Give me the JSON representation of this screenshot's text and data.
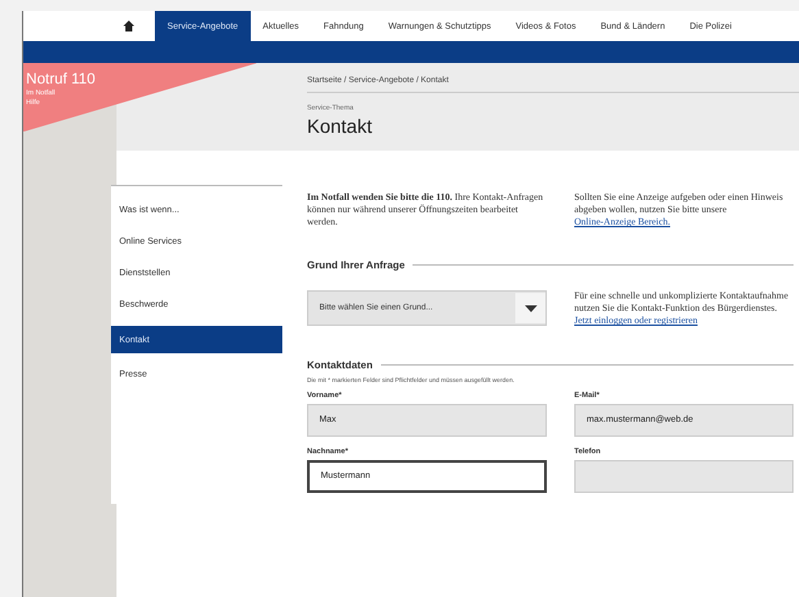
{
  "nav": {
    "items": [
      {
        "label": "Service-Angebote",
        "selected": true
      },
      {
        "label": "Aktuelles",
        "selected": false
      },
      {
        "label": "Fahndung",
        "selected": false
      },
      {
        "label": "Warnungen & Schutztipps",
        "selected": false
      },
      {
        "label": "Videos & Fotos",
        "selected": false
      },
      {
        "label": "Bund & Ländern",
        "selected": false
      },
      {
        "label": "Die Polizei",
        "selected": false
      }
    ]
  },
  "banner": {
    "title": "Notruf 110",
    "subtitle": "Im Notfall",
    "note": "Hilfe"
  },
  "breadcrumb": "Startseite / Service-Angebote / Kontakt",
  "page": {
    "kicker": "Service-Thema",
    "title": "Kontakt"
  },
  "sidebar": {
    "items": [
      {
        "label": "Was ist wenn...",
        "selected": false
      },
      {
        "label": "Online Services",
        "selected": false
      },
      {
        "label": "Dienststellen",
        "selected": false
      },
      {
        "label": "Beschwerde",
        "selected": false
      },
      {
        "label": "Kontakt",
        "selected": true
      },
      {
        "label": "Presse",
        "selected": false
      }
    ]
  },
  "intro": {
    "left": "**Im Notfall wenden Sie bitte die 110.** Ihre Kontakt-Anfragen können nur während unserer Öffnungszeiten bearbeitet werden.",
    "right": "Sollten Sie eine Anzeige aufgeben oder einen Hinweis abgeben wollen, nutzen Sie bitte unsere",
    "right_link": "Online-Anzeige Bereich."
  },
  "reason": {
    "heading": "Grund Ihrer Anfrage",
    "select": "Bitte wählen Sie einen Grund...",
    "text": "Für eine schnelle und unkomplizierte Kontaktaufnahme nutzen Sie die Kontakt-Funktion des Bürgerdienstes.",
    "link": "Jetzt einloggen oder registrieren"
  },
  "contact": {
    "heading": "Kontaktdaten",
    "note": "Die mit * markierten Felder sind Pflichtfelder und müssen ausgefüllt werden.",
    "fields": [
      {
        "label": "Vorname*",
        "value": "Max",
        "focused": false
      },
      {
        "label": "E-Mail*",
        "value": "max.mustermann@web.de",
        "focused": false
      },
      {
        "label": "Nachname*",
        "value": "Mustermann",
        "focused": true
      },
      {
        "label": "Telefon",
        "focused": false
      }
    ]
  }
}
